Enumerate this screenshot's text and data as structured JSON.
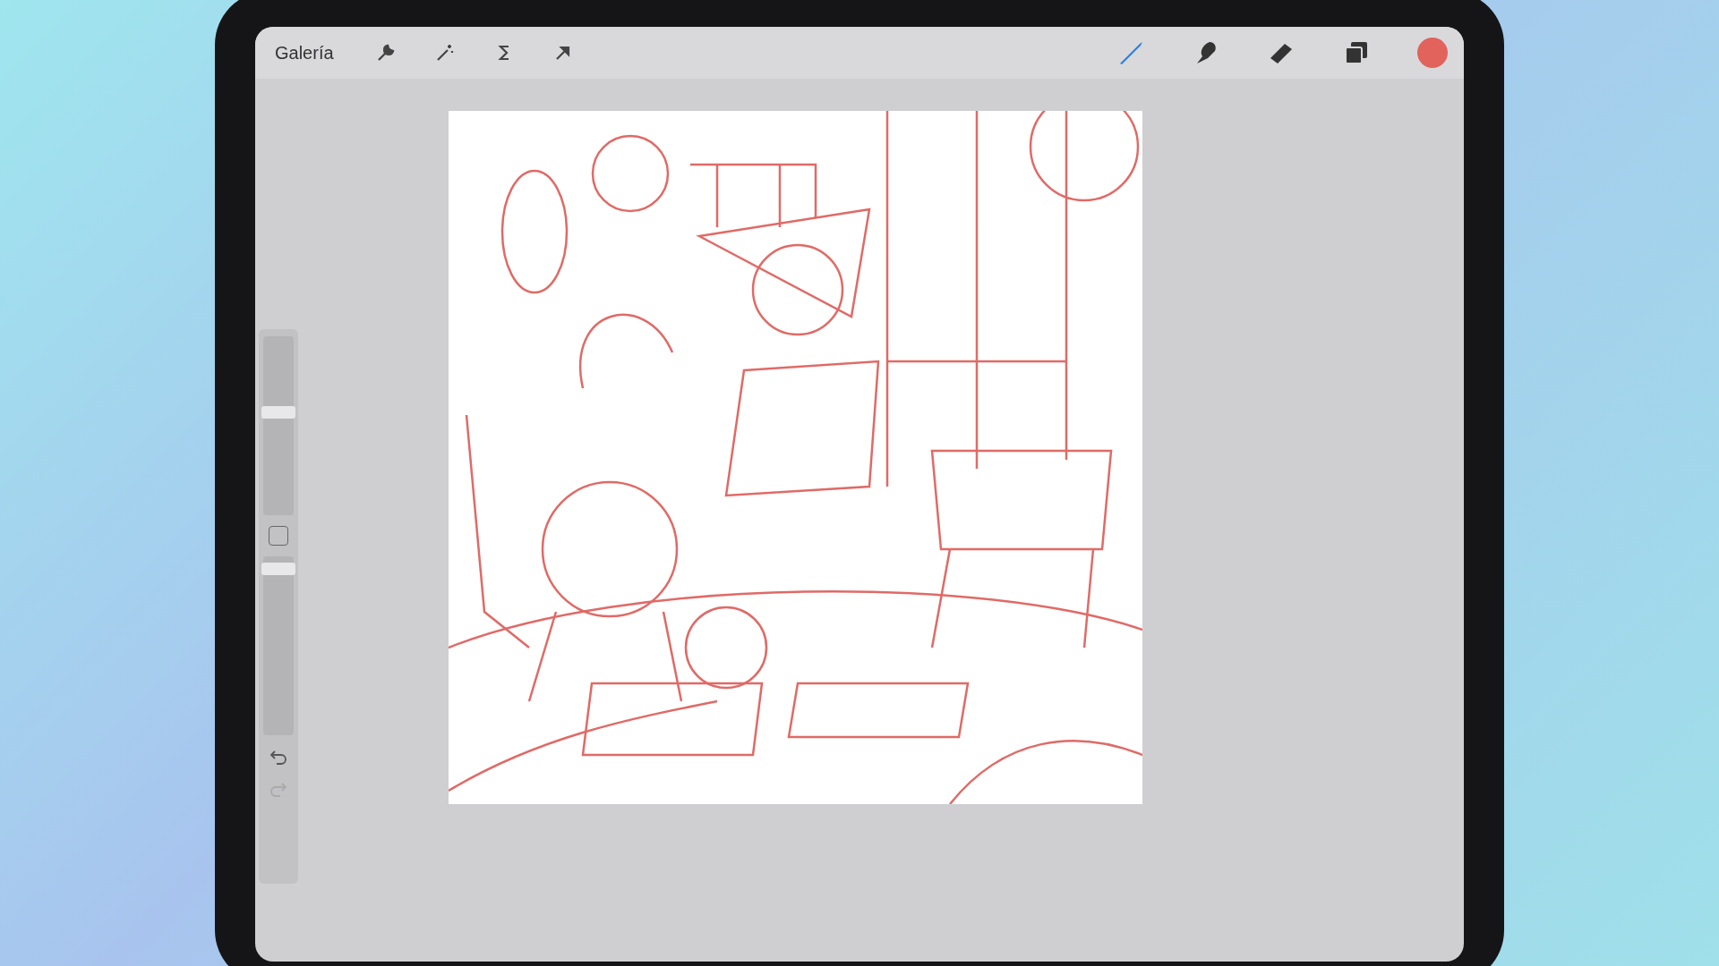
{
  "toolbar": {
    "gallery_label": "Galería",
    "left_tools": [
      {
        "kind": "wrench"
      },
      {
        "kind": "wand"
      },
      {
        "kind": "selection"
      },
      {
        "kind": "transform"
      }
    ],
    "right_tools": [
      {
        "kind": "brush",
        "selected": true
      },
      {
        "kind": "smudge",
        "selected": false
      },
      {
        "kind": "eraser",
        "selected": false
      },
      {
        "kind": "layers",
        "selected": false
      }
    ],
    "color": "#e2625c"
  },
  "sidebar": {
    "size_slider": {
      "level": 0.58
    },
    "opacity_slider": {
      "level": 0.96
    }
  }
}
